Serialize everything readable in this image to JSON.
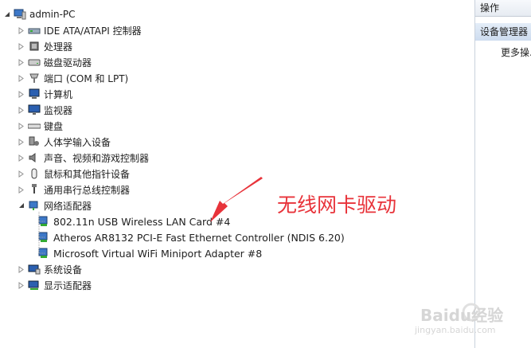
{
  "root": {
    "label": "admin-PC"
  },
  "categories": [
    {
      "label": "IDE ATA/ATAPI 控制器",
      "icon": "ide-controller-icon"
    },
    {
      "label": "处理器",
      "icon": "processor-icon"
    },
    {
      "label": "磁盘驱动器",
      "icon": "disk-drive-icon"
    },
    {
      "label": "端口 (COM 和 LPT)",
      "icon": "port-icon"
    },
    {
      "label": "计算机",
      "icon": "computer-icon"
    },
    {
      "label": "监视器",
      "icon": "monitor-icon"
    },
    {
      "label": "键盘",
      "icon": "keyboard-icon"
    },
    {
      "label": "人体学输入设备",
      "icon": "hid-icon"
    },
    {
      "label": "声音、视频和游戏控制器",
      "icon": "sound-icon"
    },
    {
      "label": "鼠标和其他指针设备",
      "icon": "mouse-icon"
    },
    {
      "label": "通用串行总线控制器",
      "icon": "usb-icon"
    },
    {
      "label": "网络适配器",
      "icon": "network-adapter-icon",
      "expanded": true
    },
    {
      "label": "系统设备",
      "icon": "system-device-icon"
    },
    {
      "label": "显示适配器",
      "icon": "display-adapter-icon"
    }
  ],
  "network_adapters": [
    {
      "label": "802.11n USB Wireless LAN Card #4"
    },
    {
      "label": "Atheros AR8132 PCI-E Fast Ethernet Controller (NDIS 6.20)"
    },
    {
      "label": "Microsoft Virtual WiFi Miniport Adapter #8"
    }
  ],
  "actions_panel": {
    "header": "操作",
    "section": "设备管理器",
    "more": "更多操..."
  },
  "annotation": {
    "text": "无线网卡驱动",
    "color": "#e8333a"
  },
  "watermark": {
    "text": "Baidu经验",
    "url": "jingyan.baidu.com"
  }
}
